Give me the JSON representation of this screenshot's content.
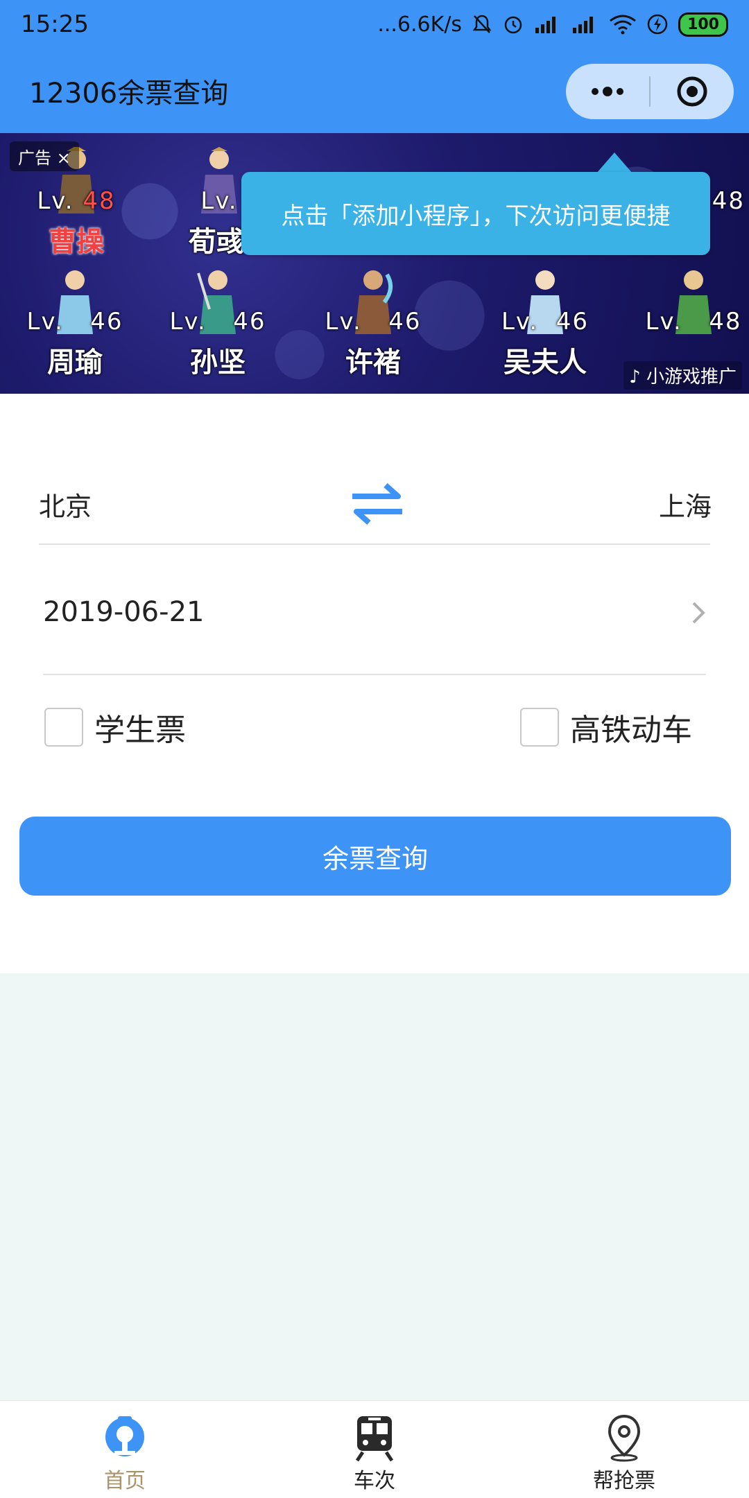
{
  "status_bar": {
    "time": "15:25",
    "network_speed": "...6.6K/s",
    "battery": "100"
  },
  "header": {
    "title": "12306余票查询"
  },
  "ad": {
    "label": "广告 ×",
    "source": "小游戏推广",
    "heroes_row1": [
      {
        "level_prefix": "Lv.",
        "level": "48",
        "name": "曹操",
        "highlight": true
      },
      {
        "level_prefix": "Lv.",
        "level": "",
        "name": "荀彧",
        "highlight": false
      },
      {
        "level_prefix": "",
        "level": "48",
        "name": "",
        "highlight": false
      }
    ],
    "heroes_row2": [
      {
        "level_prefix": "Lv.",
        "level": "46",
        "name": "周瑜"
      },
      {
        "level_prefix": "Lv.",
        "level": "46",
        "name": "孙坚"
      },
      {
        "level_prefix": "Lv.",
        "level": "46",
        "name": "许褚"
      },
      {
        "level_prefix": "Lv.",
        "level": "46",
        "name": "吴夫人"
      },
      {
        "level_prefix": "Lv.",
        "level": "48",
        "name": ""
      }
    ],
    "tooltip": "点击「添加小程序」，下次访问更便捷"
  },
  "form": {
    "from_station": "北京",
    "to_station": "上海",
    "date": "2019-06-21",
    "student_ticket_label": "学生票",
    "high_speed_label": "高铁动车",
    "query_button": "余票查询"
  },
  "tabs": [
    {
      "label": "首页",
      "icon": "railway-logo-icon",
      "active": true
    },
    {
      "label": "车次",
      "icon": "train-icon",
      "active": false
    },
    {
      "label": "帮抢票",
      "icon": "location-pin-icon",
      "active": false
    }
  ],
  "colors": {
    "primary": "#3d94f6",
    "tooltip": "#3ab2e6",
    "active_tab": "#a89468"
  }
}
